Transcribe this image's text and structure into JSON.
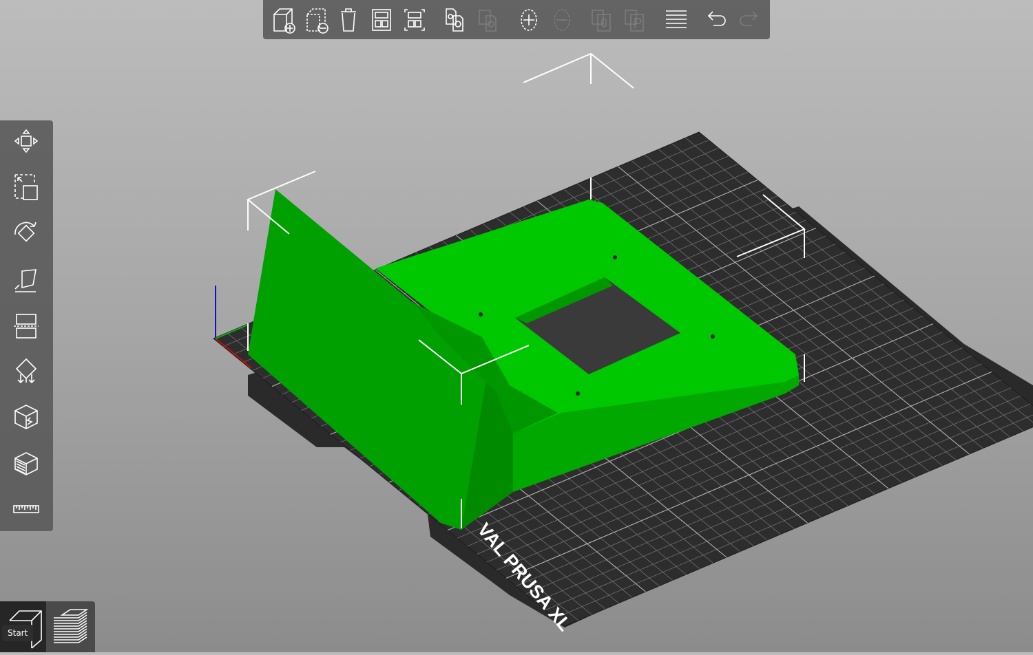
{
  "colors": {
    "model": "#00c800",
    "model_shade": "#00a000",
    "bed": "#2d2d2d",
    "grid": "#8a8a8a",
    "background_top": "#bcbcbc",
    "background_bottom": "#8c8c8c"
  },
  "bed": {
    "label": "ORIGINAL PRUSA XL",
    "visible_label": "VAL PRUSA XL"
  },
  "top_toolbar": [
    {
      "icon": "add-icon",
      "label": "Add",
      "enabled": true
    },
    {
      "icon": "delete-icon",
      "label": "Delete",
      "enabled": true
    },
    {
      "icon": "delete-all-icon",
      "label": "Delete all",
      "enabled": true
    },
    {
      "icon": "arrange-icon",
      "label": "Arrange",
      "enabled": true
    },
    {
      "icon": "arrange-selection-icon",
      "label": "Arrange selection",
      "enabled": true
    },
    {
      "icon": "copy-icon",
      "label": "Copy",
      "enabled": true
    },
    {
      "icon": "paste-icon",
      "label": "Paste",
      "enabled": false
    },
    {
      "icon": "add-instance-icon",
      "label": "Add instance",
      "enabled": true
    },
    {
      "icon": "remove-instance-icon",
      "label": "Remove instance",
      "enabled": false
    },
    {
      "icon": "split-objects-icon",
      "label": "Split to objects",
      "enabled": false
    },
    {
      "icon": "split-parts-icon",
      "label": "Split to parts",
      "enabled": false
    },
    {
      "icon": "layers-editing-icon",
      "label": "Variable layer height",
      "enabled": true
    },
    {
      "icon": "undo-icon",
      "label": "Undo",
      "enabled": true
    },
    {
      "icon": "redo-icon",
      "label": "Redo",
      "enabled": false
    }
  ],
  "left_toolbar": [
    {
      "icon": "move-icon",
      "label": "Move"
    },
    {
      "icon": "scale-icon",
      "label": "Scale"
    },
    {
      "icon": "rotate-icon",
      "label": "Rotate"
    },
    {
      "icon": "place-on-face-icon",
      "label": "Place on face"
    },
    {
      "icon": "cut-icon",
      "label": "Cut"
    },
    {
      "icon": "paint-supports-icon",
      "label": "Paint-on supports"
    },
    {
      "icon": "paint-seam-icon",
      "label": "Seam painting"
    },
    {
      "icon": "mmu-painting-icon",
      "label": "Multimaterial painting"
    },
    {
      "icon": "measure-icon",
      "label": "Measure"
    }
  ],
  "bottom_bar": {
    "view_3d": {
      "icon": "3d-view-icon",
      "tooltip": "Start",
      "active": true
    },
    "preview": {
      "icon": "preview-layers-icon",
      "active": false
    }
  }
}
